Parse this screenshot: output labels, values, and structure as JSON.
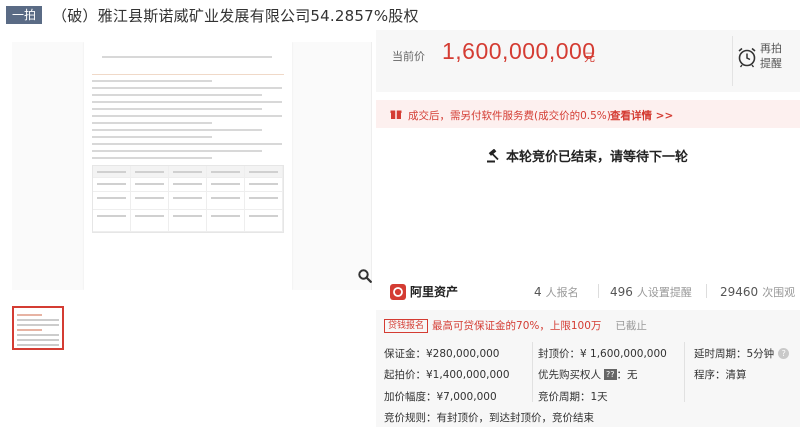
{
  "header": {
    "tag": "一拍",
    "title": "（破）雅江县斯诺威矿业发展有限公司54.2857%股权"
  },
  "price": {
    "label": "当前价",
    "value": "1,600,000,000",
    "unit": "元",
    "remind_label": "再拍\n提醒"
  },
  "notice": {
    "text": "成交后，需另付软件服务费(成交价的0.5%)",
    "link": "查看详情 >>"
  },
  "status": {
    "text": "本轮竞价已结束，请等待下一轮"
  },
  "stats": {
    "brand": "阿里资产",
    "signups": "4",
    "signups_unit": "人报名",
    "reminders": "496",
    "reminders_unit": "人设置提醒",
    "views": "29460",
    "views_unit": "次围观"
  },
  "loan": {
    "badge": "贷钱报名",
    "text": "最高可贷保证金的70%，上限100万",
    "status": "已截止"
  },
  "details": {
    "deposit": "保证金：¥280,000,000",
    "cap_price": "封顶价：¥ 1,600,000,000",
    "delay": "延时周期：5分钟",
    "start_price": "起拍价：¥1,400,000,000",
    "priority_label": "优先购买权人",
    "priority_tag": "??",
    "priority_value": "：无",
    "procedure": "程序：清算",
    "increment": "加价幅度：¥7,000,000",
    "bid_period": "竞价周期：1天",
    "rule": "竞价规则：有封顶价，到达封顶价，竞价结束"
  },
  "colors": {
    "accent": "#d43c33",
    "tag_bg": "#5a6b85"
  }
}
